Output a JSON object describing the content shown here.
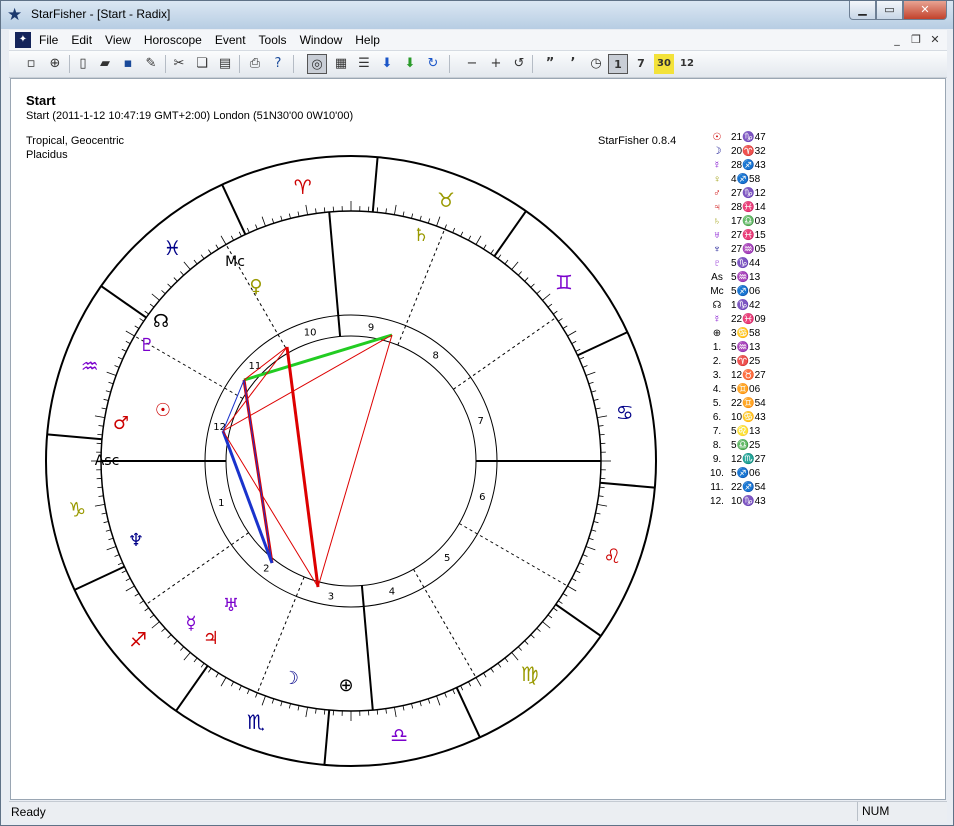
{
  "window": {
    "title": "StarFisher - [Start - Radix]",
    "app_icon": "star-icon"
  },
  "menu": [
    "File",
    "Edit",
    "View",
    "Horoscope",
    "Event",
    "Tools",
    "Window",
    "Help"
  ],
  "toolbar": {
    "buttons": [
      "new-icon",
      "globe-icon",
      "new-doc-icon",
      "open-folder-icon",
      "save-icon",
      "edit-icon",
      "cut-icon",
      "copy-icon",
      "paste-icon",
      "print-icon",
      "help-icon",
      "chart-wheel-icon",
      "grid-icon",
      "list-icon",
      "arrow-down-icon",
      "arrow-down-green-icon",
      "refresh-icon",
      "minus-icon",
      "plus-icon",
      "undo-icon",
      "quote-icon",
      "apostrophe-icon",
      "clock-icon",
      "day-1-icon",
      "day-7-icon",
      "day-30-icon",
      "month-12-icon"
    ],
    "labels": {
      "minus": "−",
      "plus": "+",
      "undo": "↺",
      "q1": "”",
      "q2": "’",
      "d1": "1",
      "d7": "7",
      "d30": "30",
      "d12": "12"
    }
  },
  "chart": {
    "title": "Start",
    "subtitle": "Start (2011-1-12 10:47:19 GMT+2:00) London (51N30'00 0W10'00)",
    "line1": "Tropical, Geocentric",
    "line2": "Placidus",
    "version": "StarFisher 0.8.4",
    "asc_label": "Asc",
    "mc_label": "Mc"
  },
  "zodiac_signs": [
    "♒",
    "♑",
    "♐",
    "♏",
    "♎",
    "♍",
    "♌",
    "♋",
    "♊",
    "♉",
    "♈",
    "♓"
  ],
  "house_numbers": [
    "1",
    "2",
    "3",
    "4",
    "5",
    "6",
    "7",
    "8",
    "9",
    "10",
    "11",
    "12"
  ],
  "planets_in_chart": [
    {
      "glyph": "☉",
      "color": "#cc0000"
    },
    {
      "glyph": "♂",
      "color": "#cc0000"
    },
    {
      "glyph": "♇",
      "color": "#7a00cc"
    },
    {
      "glyph": "☊",
      "color": "#000000"
    },
    {
      "glyph": "♅",
      "color": "#7a00cc"
    },
    {
      "glyph": "♀",
      "color": "#999900"
    },
    {
      "glyph": "♄",
      "color": "#999900"
    },
    {
      "glyph": "♆",
      "color": "#000088"
    },
    {
      "glyph": "♃",
      "color": "#cc0000"
    },
    {
      "glyph": "☿",
      "color": "#7a00cc"
    },
    {
      "glyph": "☽",
      "color": "#000088"
    },
    {
      "glyph": "⊕",
      "color": "#000000"
    }
  ],
  "positions": [
    {
      "glyph": "☉",
      "value": "21♑47",
      "color": "#cc0000"
    },
    {
      "glyph": "☽",
      "value": "20♈32",
      "color": "#000088"
    },
    {
      "glyph": "☿",
      "value": "28♐43",
      "color": "#7a00cc"
    },
    {
      "glyph": "♀",
      "value": "4♐58",
      "color": "#999900"
    },
    {
      "glyph": "♂",
      "value": "27♑12",
      "color": "#cc0000"
    },
    {
      "glyph": "♃",
      "value": "28♓14",
      "color": "#cc0000"
    },
    {
      "glyph": "♄",
      "value": "17♎03",
      "color": "#999900"
    },
    {
      "glyph": "♅",
      "value": "27♓15",
      "color": "#7a00cc"
    },
    {
      "glyph": "♆",
      "value": "27♒05",
      "color": "#000088"
    },
    {
      "glyph": "♇",
      "value": "5♑44",
      "color": "#7a00cc"
    },
    {
      "glyph": "As",
      "value": "5♒13",
      "color": "#000000"
    },
    {
      "glyph": "Mc",
      "value": "5♐06",
      "color": "#000000"
    },
    {
      "glyph": "☊",
      "value": "1♑42",
      "color": "#000000"
    },
    {
      "glyph": "☿",
      "value": "22♓09",
      "color": "#7a00cc"
    },
    {
      "glyph": "⊕",
      "value": "3♋58",
      "color": "#000000"
    },
    {
      "glyph": "1.",
      "value": "5♒13",
      "color": "#000000"
    },
    {
      "glyph": "2.",
      "value": "5♈25",
      "color": "#000000"
    },
    {
      "glyph": "3.",
      "value": "12♉27",
      "color": "#000000"
    },
    {
      "glyph": "4.",
      "value": "5♊06",
      "color": "#000000"
    },
    {
      "glyph": "5.",
      "value": "22♊54",
      "color": "#000000"
    },
    {
      "glyph": "6.",
      "value": "10♋43",
      "color": "#000000"
    },
    {
      "glyph": "7.",
      "value": "5♌13",
      "color": "#000000"
    },
    {
      "glyph": "8.",
      "value": "5♎25",
      "color": "#000000"
    },
    {
      "glyph": "9.",
      "value": "12♏27",
      "color": "#000000"
    },
    {
      "glyph": "10.",
      "value": "5♐06",
      "color": "#000000"
    },
    {
      "glyph": "11.",
      "value": "22♐54",
      "color": "#000000"
    },
    {
      "glyph": "12.",
      "value": "10♑43",
      "color": "#000000"
    }
  ],
  "status": {
    "left": "Ready",
    "num": "NUM"
  }
}
